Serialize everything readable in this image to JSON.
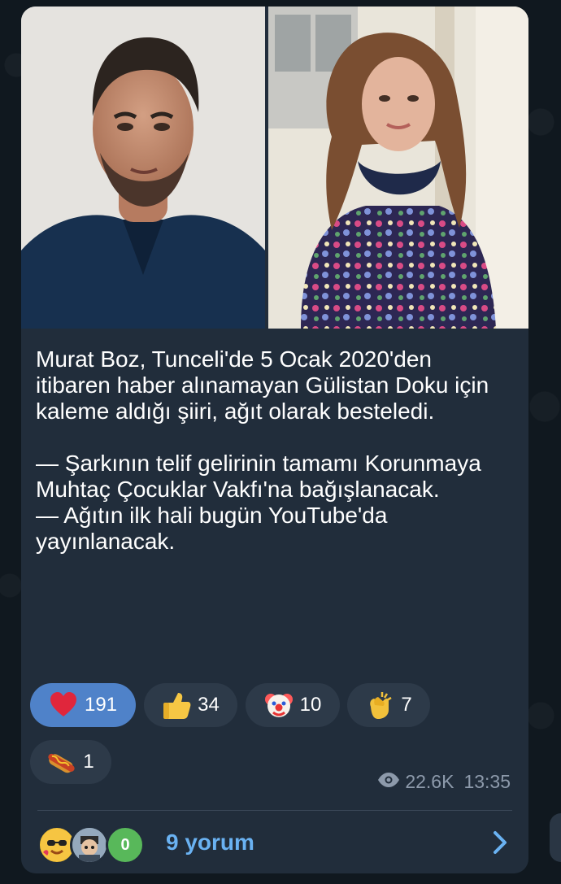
{
  "post": {
    "text_paragraphs": [
      "Murat Boz, Tunceli'de 5 Ocak 2020'den itibaren haber alınamayan Gülistan Doku için kaleme aldığı şiiri, ağıt olarak besteledi.",
      "",
      "— Şarkının telif gelirinin tamamı Korunmaya Muhtaç Çocuklar Vakfı'na bağışlanacak.",
      "— Ağıtın ilk hali bugün YouTube'da yayınlanacak."
    ]
  },
  "reactions": [
    {
      "emoji": "heart-icon",
      "count": "191",
      "active": true
    },
    {
      "emoji": "thumbs-up-icon",
      "count": "34",
      "active": false
    },
    {
      "emoji": "clown-face-icon",
      "count": "10",
      "active": false
    },
    {
      "emoji": "clapping-hands-icon",
      "count": "7",
      "active": false
    },
    {
      "emoji": "hot-dog-icon",
      "count": "1",
      "active": false
    }
  ],
  "meta": {
    "views": "22.6K",
    "time": "13:35"
  },
  "comments": {
    "label": "9 yorum",
    "avatar_badge": "0"
  },
  "colors": {
    "bubble": "#212d3b",
    "accent": "#6ab2f2",
    "reaction_active": "#4f82c9",
    "reaction_bg": "#2d3a49",
    "meta_text": "#8d9aab"
  }
}
